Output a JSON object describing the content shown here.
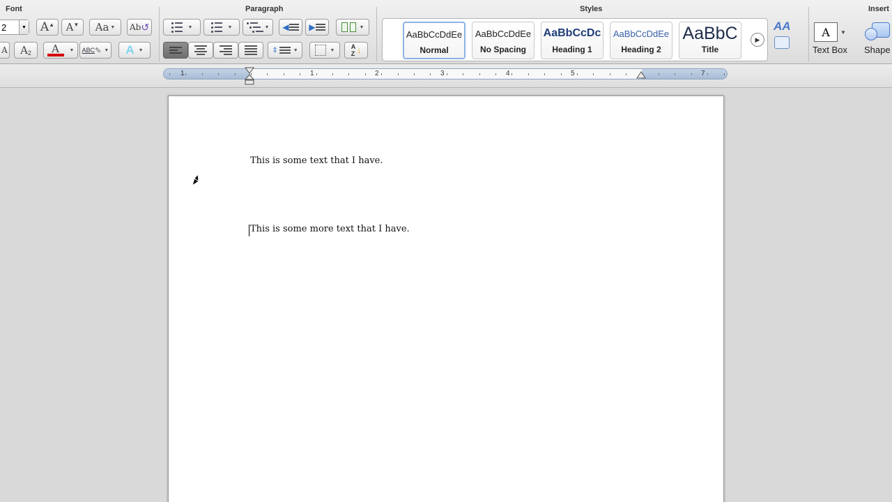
{
  "ribbon": {
    "groups": {
      "font": "Font",
      "paragraph": "Paragraph",
      "styles": "Styles",
      "insert": "Insert"
    },
    "font": {
      "size_value": "2",
      "grow_label": "A",
      "shrink_label": "A",
      "change_case_label": "Aa",
      "clear_format_label": "Ab",
      "superscript_label": "A",
      "subscript_label": "A",
      "font_color_label": "A",
      "highlight_label": "ABC",
      "text_effects_label": "A"
    },
    "styles": {
      "tiles": [
        {
          "sample": "AaBbCcDdEe",
          "name": "Normal"
        },
        {
          "sample": "AaBbCcDdEe",
          "name": "No Spacing"
        },
        {
          "sample": "AaBbCcDc",
          "name": "Heading 1"
        },
        {
          "sample": "AaBbCcDdEe",
          "name": "Heading 2"
        },
        {
          "sample": "AaBbC",
          "name": "Title"
        }
      ],
      "change_styles_label": "AA"
    },
    "insert": {
      "text_box_label": "Text Box",
      "shape_label": "Shape"
    }
  },
  "ruler": {
    "numbers": [
      "1",
      "1",
      "2",
      "3",
      "4",
      "5",
      "7"
    ]
  },
  "document": {
    "paragraphs": [
      "This is some text that I have.",
      "This is some more text that I have."
    ]
  },
  "colors": {
    "font_color_bar": "#d40000",
    "style_selected_border": "#8bb2e3",
    "ruler_blue": "#a8bcd6"
  }
}
